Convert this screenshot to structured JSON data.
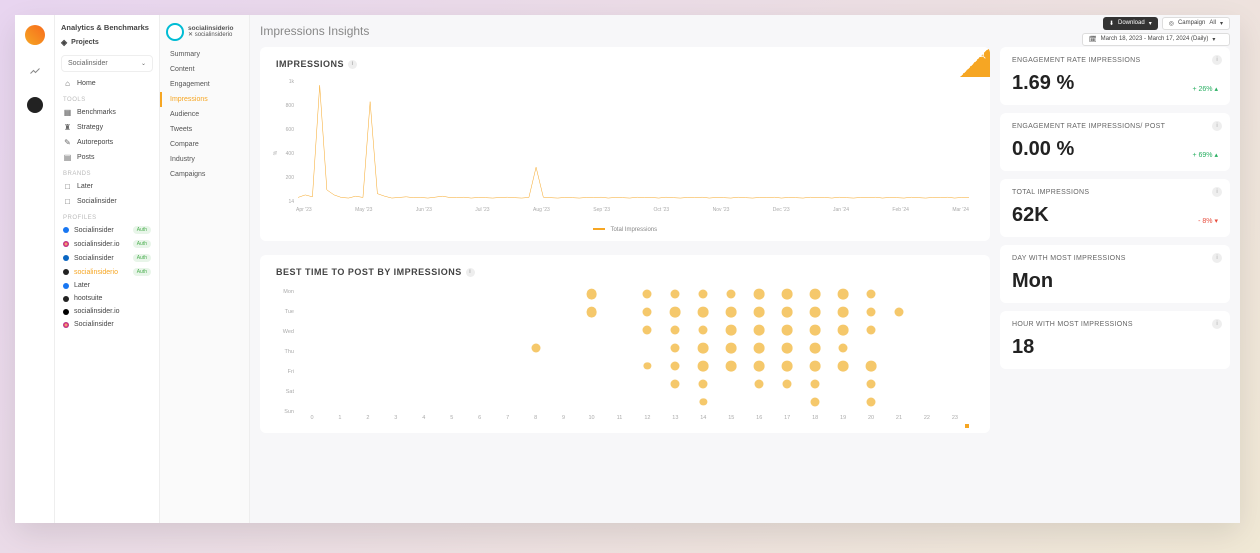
{
  "app_title": "Analytics & Benchmarks",
  "projects_label": "Projects",
  "project_select": "Socialinsider",
  "nav": {
    "home": "Home",
    "tools_head": "TOOLS",
    "tools": [
      "Benchmarks",
      "Strategy",
      "Autoreports",
      "Posts"
    ],
    "brands_head": "BRANDS",
    "brands": [
      "Later",
      "Socialinsider"
    ],
    "profiles_head": "PROFILES",
    "profiles": [
      {
        "name": "Socialinsider",
        "net": "fb",
        "badge": "Auth"
      },
      {
        "name": "socialinsider.io",
        "net": "ig",
        "badge": "Auth"
      },
      {
        "name": "Socialinsider",
        "net": "li",
        "badge": "Auth"
      },
      {
        "name": "socialinsiderio",
        "net": "tw",
        "badge": "Auth",
        "active": true
      },
      {
        "name": "Later",
        "net": "fb"
      },
      {
        "name": "hootsuite",
        "net": "tw"
      },
      {
        "name": "socialinsider.io",
        "net": "th"
      },
      {
        "name": "Socialinsider",
        "net": "ig"
      }
    ]
  },
  "subnav": {
    "brand_name": "socialinsiderio",
    "brand_handle": "✕ socialinsiderio",
    "items": [
      "Summary",
      "Content",
      "Engagement",
      "Impressions",
      "Audience",
      "Tweets",
      "Compare",
      "Industry",
      "Campaigns"
    ],
    "active": "Impressions"
  },
  "page": {
    "title": "Impressions Insights",
    "download": "Download",
    "campaign_label": "Campaign",
    "campaign_value": "All",
    "date_range": "March 18, 2023 - March 17, 2024 (Daily)"
  },
  "metrics": [
    {
      "title": "ENGAGEMENT RATE IMPRESSIONS",
      "value": "1.69 %",
      "delta": "+ 26%",
      "dir": "up"
    },
    {
      "title": "ENGAGEMENT RATE IMPRESSIONS/ POST",
      "value": "0.00 %",
      "delta": "+ 69%",
      "dir": "up"
    },
    {
      "title": "TOTAL IMPRESSIONS",
      "value": "62K",
      "delta": "- 8%",
      "dir": "down"
    },
    {
      "title": "DAY WITH MOST IMPRESSIONS",
      "value": "Mon"
    },
    {
      "title": "HOUR WITH MOST IMPRESSIONS",
      "value": "18"
    }
  ],
  "chart_data": [
    {
      "type": "line",
      "title": "IMPRESSIONS",
      "ylabel": "%",
      "yticks": [
        "1k",
        "800",
        "600",
        "400",
        "200",
        "14"
      ],
      "xticks": [
        "Apr '23",
        "May '23",
        "Jun '23",
        "Jul '23",
        "Aug '23",
        "Sep '23",
        "Oct '23",
        "Nov '23",
        "Dec '23",
        "Jan '24",
        "Feb '24",
        "Mar '24"
      ],
      "legend": "Total Impressions",
      "series": [
        {
          "name": "Total Impressions",
          "values": [
            60,
            80,
            65,
            950,
            120,
            80,
            60,
            55,
            70,
            60,
            820,
            90,
            70,
            55,
            60,
            65,
            58,
            60,
            55,
            62,
            70,
            60,
            58,
            62,
            55,
            60,
            58,
            55,
            60,
            62,
            58,
            55,
            60,
            300,
            62,
            58,
            55,
            60,
            58,
            55,
            60,
            58,
            62,
            55,
            60,
            58,
            55,
            62,
            58,
            60,
            55,
            62,
            58,
            55,
            60,
            58,
            62,
            55,
            60,
            58,
            55,
            62,
            58,
            55,
            60,
            58,
            62,
            55,
            60,
            58,
            55,
            62,
            58,
            60,
            55,
            62,
            58,
            55,
            60,
            58,
            62,
            55,
            60,
            58,
            55,
            62,
            58,
            55,
            60,
            58,
            62,
            55,
            60,
            58
          ]
        }
      ]
    },
    {
      "type": "heatmap",
      "title": "BEST TIME TO POST BY IMPRESSIONS",
      "y_categories": [
        "Mon",
        "Tue",
        "Wed",
        "Thu",
        "Fri",
        "Sat",
        "Sun"
      ],
      "x_range": [
        0,
        23
      ],
      "points": [
        {
          "day": "Mon",
          "hours": [
            10,
            12,
            13,
            14,
            15,
            16,
            17,
            18,
            19,
            20
          ],
          "sizes": [
            6,
            5,
            5,
            5,
            5,
            6,
            6,
            6,
            6,
            5
          ]
        },
        {
          "day": "Tue",
          "hours": [
            10,
            12,
            13,
            14,
            15,
            16,
            17,
            18,
            19,
            20,
            21
          ],
          "sizes": [
            6,
            5,
            6,
            6,
            6,
            6,
            6,
            6,
            6,
            5,
            5
          ]
        },
        {
          "day": "Wed",
          "hours": [
            12,
            13,
            14,
            15,
            16,
            17,
            18,
            19,
            20
          ],
          "sizes": [
            5,
            5,
            5,
            6,
            6,
            6,
            6,
            6,
            5
          ]
        },
        {
          "day": "Thu",
          "hours": [
            8,
            13,
            14,
            15,
            16,
            17,
            18,
            19
          ],
          "sizes": [
            5,
            5,
            6,
            6,
            6,
            6,
            6,
            5
          ]
        },
        {
          "day": "Fri",
          "hours": [
            12,
            13,
            14,
            15,
            16,
            17,
            18,
            19,
            20
          ],
          "sizes": [
            4,
            5,
            6,
            6,
            6,
            6,
            6,
            6,
            6
          ]
        },
        {
          "day": "Sat",
          "hours": [
            13,
            14,
            16,
            17,
            18,
            20
          ],
          "sizes": [
            5,
            5,
            5,
            5,
            5,
            5
          ]
        },
        {
          "day": "Sun",
          "hours": [
            14,
            18,
            20
          ],
          "sizes": [
            4,
            5,
            5
          ]
        }
      ]
    }
  ]
}
